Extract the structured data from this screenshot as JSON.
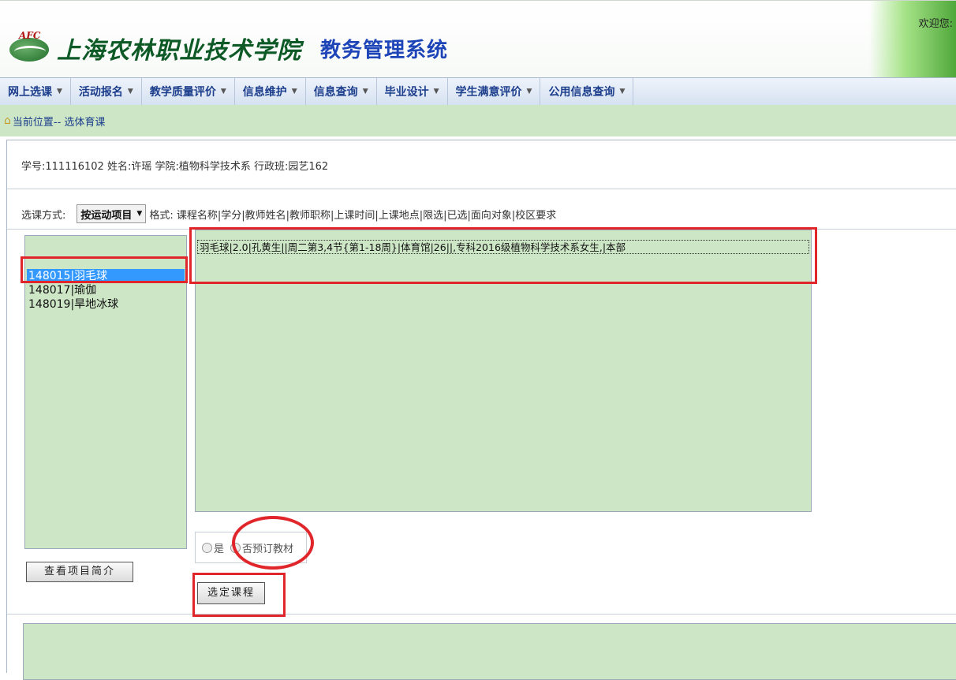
{
  "header": {
    "emblem_text": "AFC",
    "school_name": "上海农林职业技术学院",
    "system_name": "教务管理系统",
    "welcome": "欢迎您:"
  },
  "menu": [
    {
      "label": "网上选课"
    },
    {
      "label": "活动报名"
    },
    {
      "label": "教学质量评价"
    },
    {
      "label": "信息维护"
    },
    {
      "label": "信息查询"
    },
    {
      "label": "毕业设计"
    },
    {
      "label": "学生满意评价"
    },
    {
      "label": "公用信息查询"
    }
  ],
  "location": {
    "prefix": "当前位置",
    "path": " -- 选体育课"
  },
  "student_info": "学号:111116102  姓名:许瑶  学院:植物科学技术系  行政班:园艺162",
  "method": {
    "label": "选课方式:",
    "selected": "按运动项目",
    "format": "格式: 课程名称|学分|教师姓名|教师职称|上课时间|上课地点|限选|已选|面向对象|校区要求"
  },
  "projects": [
    {
      "label": "148015|羽毛球",
      "selected": true
    },
    {
      "label": "148017|瑜伽",
      "selected": false
    },
    {
      "label": "148019|旱地冰球",
      "selected": false
    }
  ],
  "courses": [
    {
      "label": "羽毛球|2.0|孔黄生||周二第3,4节{第1-18周}|体育馆|26||,专科2016级植物科学技术系女生,|本部"
    }
  ],
  "textbook_options": {
    "yes": "是",
    "no": "否预订教材"
  },
  "buttons": {
    "view_intro": "查看项目简介",
    "select_course": "选定课程"
  },
  "colors": {
    "panel_green": "#cde6c6",
    "annotation_red": "#e0262b",
    "menu_text": "#1c3e8c",
    "selection_blue": "#3399ff"
  }
}
